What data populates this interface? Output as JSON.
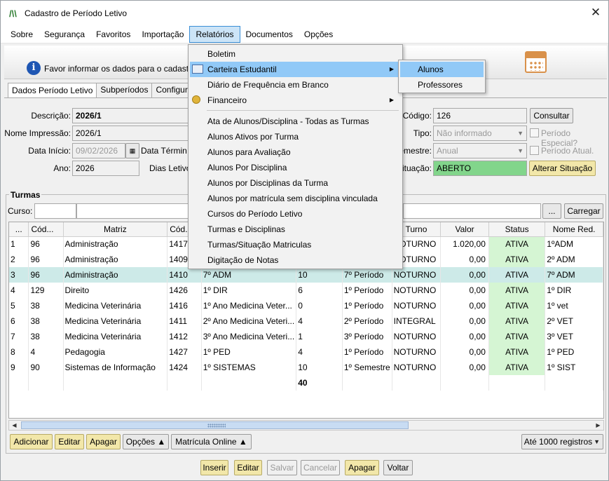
{
  "window": {
    "title": "Cadastro de Período Letivo",
    "close_glyph": "✕"
  },
  "menubar": [
    "Sobre",
    "Segurança",
    "Favoritos",
    "Importação",
    "Relatórios",
    "Documentos",
    "Opções"
  ],
  "info": {
    "text": "Favor informar os dados para o cadastr"
  },
  "tabs": [
    "Dados Período Letivo",
    "Subperíodos",
    "Configur"
  ],
  "form": {
    "descricao_label": "Descrição:",
    "descricao": "2026/1",
    "nome_impressao_label": "Nome Impressão:",
    "nome_impressao": "2026/1",
    "data_inicio_label": "Data Início:",
    "data_inicio": "09/02/2026",
    "data_termino_label": "Data Términ",
    "ano_label": "Ano:",
    "ano": "2026",
    "dias_letivos_label": "Dias Letivo",
    "codigo_label": "Código:",
    "codigo": "126",
    "consultar": "Consultar",
    "tipo_label": "Tipo:",
    "tipo": "Não informado",
    "periodo_especial": "Período Especial?",
    "semestre_label": "emestre:",
    "semestre": "Anual",
    "periodo_atual": "Período Atual.",
    "situacao_label": "ituação:",
    "situacao": "ABERTO",
    "alterar_situacao": "Alterar Situação"
  },
  "turmas": {
    "title": "Turmas",
    "curso_label": "Curso:",
    "browse": "...",
    "carregar": "Carregar",
    "columns": [
      "...",
      "Cód...",
      "Matriz",
      "Cód.",
      "",
      "",
      "Turno",
      "Valor",
      "Status",
      "Nome Red."
    ],
    "rows": [
      [
        "1",
        "96",
        "Administração",
        "1417",
        "",
        "",
        "NOTURNO",
        "1.020,00",
        "ATIVA",
        "1ºADM"
      ],
      [
        "2",
        "96",
        "Administração",
        "1409",
        "",
        "",
        "NOTURNO",
        "0,00",
        "ATIVA",
        "2º ADM"
      ],
      [
        "3",
        "96",
        "Administração",
        "1410",
        "7º ADM",
        "10",
        "7º Período",
        "NOTURNO",
        "0,00",
        "ATIVA",
        "7º ADM"
      ],
      [
        "4",
        "129",
        "Direito",
        "1426",
        "1º DIR",
        "6",
        "1º Período",
        "NOTURNO",
        "0,00",
        "ATIVA",
        "1º DIR"
      ],
      [
        "5",
        "38",
        "Medicina Veterinária",
        "1416",
        "1º  Ano Medicina Veter...",
        "0",
        "1º Período",
        "NOTURNO",
        "0,00",
        "ATIVA",
        "1º vet"
      ],
      [
        "6",
        "38",
        "Medicina Veterinária",
        "1411",
        "2º Ano Medicina Veteri...",
        "4",
        "2º Período",
        "INTEGRAL",
        "0,00",
        "ATIVA",
        "2º VET"
      ],
      [
        "7",
        "38",
        "Medicina Veterinária",
        "1412",
        "3º Ano Medicina Veteri...",
        "1",
        "3º Período",
        "NOTURNO",
        "0,00",
        "ATIVA",
        "3º VET"
      ],
      [
        "8",
        "4",
        "Pedagogia",
        "1427",
        "1º PED",
        "4",
        "1º Período",
        "NOTURNO",
        "0,00",
        "ATIVA",
        "1º PED"
      ],
      [
        "9",
        "90",
        "Sistemas de Informação",
        "1424",
        "1º SISTEMAS",
        "10",
        "1º Semestre",
        "NOTURNO",
        "0,00",
        "ATIVA",
        "1º SIST"
      ]
    ],
    "total": "40",
    "buttons": {
      "adicionar": "Adicionar",
      "editar": "Editar",
      "apagar": "Apagar",
      "opcoes": "Opções ▲",
      "matricula_online": "Matrícula Online ▲",
      "limit": "Até 1000 registros"
    }
  },
  "footer": {
    "inserir": "Inserir",
    "editar": "Editar",
    "salvar": "Salvar",
    "cancelar": "Cancelar",
    "apagar": "Apagar",
    "voltar": "Voltar"
  },
  "relatorios_menu": {
    "items": [
      "Boletim",
      "Carteira Estudantil",
      "Diário de Frequência em Branco",
      "Financeiro",
      "Ata de Alunos/Disciplina - Todas as Turmas",
      "Alunos Ativos por Turma",
      "Alunos para Avaliação",
      "Alunos Por Disciplina",
      "Alunos por Disciplinas da Turma",
      "Alunos por matrícula sem disciplina vinculada",
      "Cursos do Período Letivo",
      "Turmas e Disciplinas",
      "Turmas/Situação Matriculas",
      "Digitação de Notas"
    ],
    "submenu": [
      "Alunos",
      "Professores"
    ]
  },
  "colors": {
    "selected_row": "#cdeae8",
    "status_bg": "#d5f5d3",
    "menu_highlight": "#91c9f7",
    "situacao_green": "#82d58b"
  }
}
